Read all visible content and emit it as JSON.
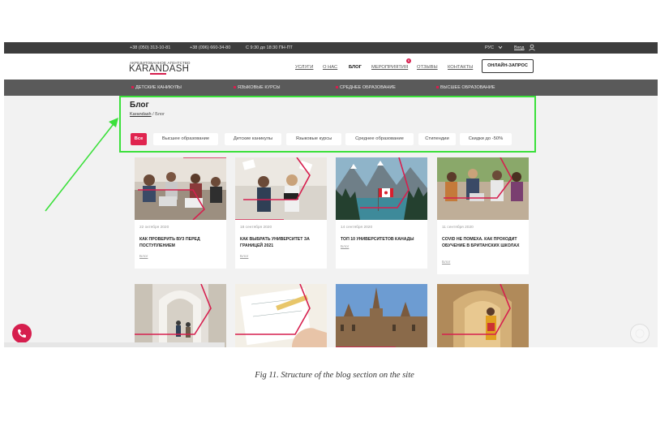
{
  "topbar": {
    "phone1": "+38 (050) 313-10-81",
    "phone2": "+38 (096) 660-34-80",
    "hours": "С 9:30 до 18:30 ПН-ПТ",
    "language": "РУС",
    "login": "Вход"
  },
  "header": {
    "logo_small": "АКРЕДИТОВАННОЕ АГЕНТСТВО",
    "logo": "KARANDASH",
    "nav": [
      {
        "label": "УСЛУГИ"
      },
      {
        "label": "О НАС"
      },
      {
        "label": "БЛОГ"
      },
      {
        "label": "МЕРОПРИЯТИЯ"
      },
      {
        "label": "ОТЗЫВЫ"
      },
      {
        "label": "КОНТАКТЫ"
      }
    ],
    "events_badge": "6",
    "cta": "ОНЛАЙН-ЗАПРОС"
  },
  "categories": [
    {
      "label": "ДЕТСКИЕ КАНИКУЛЫ"
    },
    {
      "label": "ЯЗЫКОВЫЕ КУРСЫ"
    },
    {
      "label": "СРЕДНЕЕ ОБРАЗОВАНИЕ"
    },
    {
      "label": "ВЫСШЕЕ ОБРАЗОВАНИЕ"
    }
  ],
  "blog": {
    "title": "Блог",
    "breadcrumb_home": "Karandash",
    "breadcrumb_sep": " / ",
    "breadcrumb_current": "Блог",
    "filters": [
      {
        "label": "Все"
      },
      {
        "label": "Высшее образование"
      },
      {
        "label": "Детские каникулы"
      },
      {
        "label": "Языковые курсы"
      },
      {
        "label": "Среднее образование"
      },
      {
        "label": "Стипендии"
      },
      {
        "label": "Скидки до -50%"
      }
    ]
  },
  "posts": [
    {
      "date": "22 октября 2020",
      "title": "КАК ПРОВЕРИТЬ ВУЗ ПЕРЕД ПОСТУПЛЕНИЕМ",
      "tag": "Блог"
    },
    {
      "date": "18 сентября 2020",
      "title": "КАК ВЫБРАТЬ УНИВЕРСИТЕТ ЗА ГРАНИЦЕЙ 2021",
      "tag": "Блог"
    },
    {
      "date": "14 сентября 2020",
      "title": "ТОП 10 УНИВЕРСИТЕТОВ КАНАДЫ",
      "tag": "Блог"
    },
    {
      "date": "11 сентября 2020",
      "title": "COVID НЕ ПОМЕХА. КАК ПРОХОДИТ ОБУЧЕНИЕ В БРИТАНСКИХ ШКОЛАХ",
      "tag": "Блог"
    }
  ],
  "colors": {
    "accent": "#d61f4e",
    "highlight": "#3be03b",
    "dark_bar": "#3d3d3d",
    "category_bar": "#5a5a5a"
  },
  "icons": [
    "user-icon",
    "chevron-down-icon",
    "phone-icon",
    "chat-icon",
    "arrow-annotation"
  ],
  "caption": "Fig 11. Structure of the blog section on the site"
}
